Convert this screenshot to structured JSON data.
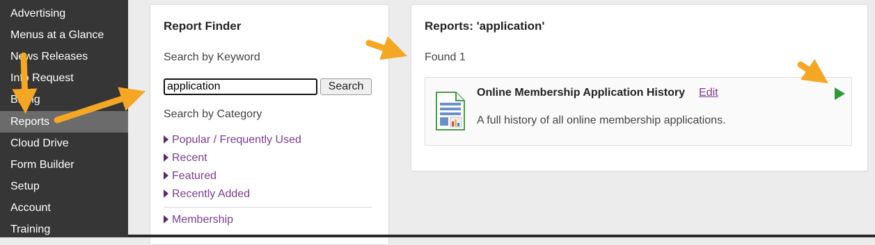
{
  "sidebar": {
    "items": [
      {
        "label": "Advertising"
      },
      {
        "label": "Menus at a Glance"
      },
      {
        "label": "News Releases"
      },
      {
        "label": "Info Request"
      },
      {
        "label": "Billing"
      },
      {
        "label": "Reports",
        "active": true
      },
      {
        "label": "Cloud Drive"
      },
      {
        "label": "Form Builder"
      },
      {
        "label": "Setup"
      },
      {
        "label": "Account"
      },
      {
        "label": "Training"
      }
    ]
  },
  "finder": {
    "title": "Report Finder",
    "keyword_label": "Search by Keyword",
    "search_value": "application",
    "search_button": "Search",
    "category_label": "Search by Category",
    "categories": [
      {
        "label": "Popular / Frequently Used"
      },
      {
        "label": "Recent"
      },
      {
        "label": "Featured"
      },
      {
        "label": "Recently Added"
      },
      {
        "label": "Membership"
      }
    ]
  },
  "results": {
    "title": "Reports: 'application'",
    "found": "Found 1",
    "report": {
      "name": "Online Membership Application History",
      "edit_label": "Edit",
      "description": "A full history of all online membership applications.",
      "icon": "spreadsheet-icon",
      "action_icon": "play-icon"
    }
  },
  "colors": {
    "sidebar_bg": "#363636",
    "sidebar_active": "#6b6b6b",
    "link": "#7a3d8c",
    "run": "#2e9a36",
    "annotation_arrow": "#f5a623"
  }
}
